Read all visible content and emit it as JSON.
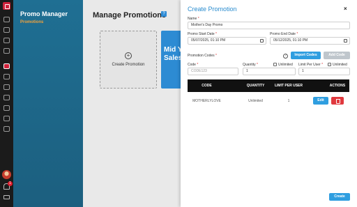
{
  "nav": {
    "title": "Promo Manager",
    "subtitle": "Promotions",
    "subtitle_color": "#f4a23a"
  },
  "rail": {
    "icons": [
      "logo-icon",
      "users-icon",
      "share-icon",
      "ticket-icon",
      "calendar-icon",
      "wifi-icon",
      "promo-icon",
      "contacts-icon",
      "headset-icon",
      "chart-icon",
      "chat-icon",
      "checkbox-icon",
      "document-icon",
      "list-icon",
      "history-icon"
    ],
    "notification_count": "1"
  },
  "main": {
    "heading": "Manage Promotions",
    "help_glyph": "?",
    "create_card_label": "Create Promotion",
    "promo_card_text": "Mid Y\nSales"
  },
  "panel": {
    "title": "Create Promotion",
    "close_glyph": "×",
    "name_label": "Name",
    "name_value": "Mother's Day Promo",
    "start_label": "Promo Start Date",
    "start_value": "05/07/2025, 01:10 PM",
    "end_label": "Promo End Date",
    "end_value": "05/12/2025, 01:10 PM",
    "codes_label": "Promotion Codes",
    "help_glyph": "?",
    "import_label": "Import Codes",
    "add_label": "Add Code",
    "code_label": "Code",
    "code_placeholder": "CODE123",
    "quantity_label": "Quantity",
    "quantity_value": "1",
    "unlimited_label": "Unlimited",
    "limit_label": "Limit Per User",
    "limit_value": "1",
    "unlimited_label_2": "Unlimited",
    "table": {
      "headers": [
        "CODE",
        "QUANTITY",
        "LIMIT PER USER",
        "ACTIONS"
      ],
      "rows": [
        {
          "code": "MOTHERLYLOVE",
          "quantity": "Unlimited",
          "limit": "1",
          "edit_label": "Edit"
        }
      ]
    },
    "create_label": "Create",
    "accent_color": "#2f9ee0"
  }
}
